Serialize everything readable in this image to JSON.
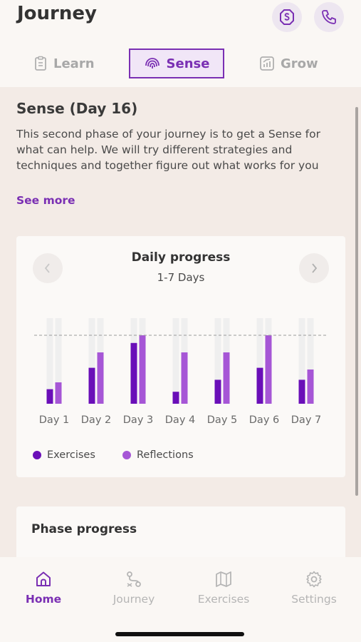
{
  "header": {
    "title": "Journey",
    "sos_icon": "sos-icon",
    "phone_icon": "phone-icon"
  },
  "tabs": [
    {
      "label": "Learn",
      "icon": "clipboard-icon",
      "active": false
    },
    {
      "label": "Sense",
      "icon": "fingerprint-icon",
      "active": true
    },
    {
      "label": "Grow",
      "icon": "growth-chart-icon",
      "active": false
    }
  ],
  "section": {
    "title": "Sense (Day 16)",
    "description": "This second phase of your journey is to get a Sense for what can help. We will try different strategies and techniques and together figure out what works for you",
    "see_more": "See more"
  },
  "daily_progress": {
    "title": "Daily progress",
    "subtitle": "1-7 Days",
    "legend": [
      "Exercises",
      "Reflections"
    ]
  },
  "chart_data": {
    "type": "bar",
    "title": "Daily progress",
    "subtitle": "1-7 Days",
    "categories": [
      "Day 1",
      "Day 2",
      "Day 3",
      "Day 4",
      "Day 5",
      "Day 6",
      "Day 7"
    ],
    "series": [
      {
        "name": "Exercises",
        "values": [
          0.17,
          0.42,
          0.71,
          0.14,
          0.28,
          0.42,
          0.28
        ]
      },
      {
        "name": "Reflections",
        "values": [
          0.25,
          0.6,
          0.8,
          0.6,
          0.6,
          0.8,
          0.4
        ]
      }
    ],
    "ylim": [
      0,
      1
    ],
    "target_line": 0.8,
    "colors": {
      "Exercises": "#6a0fb8",
      "Reflections": "#a656d6",
      "track": "#efefef"
    }
  },
  "phase_progress": {
    "title": "Phase progress"
  },
  "bottom_nav": [
    {
      "label": "Home",
      "icon": "home-icon",
      "active": true
    },
    {
      "label": "Journey",
      "icon": "journey-icon",
      "active": false
    },
    {
      "label": "Exercises",
      "icon": "map-icon",
      "active": false
    },
    {
      "label": "Settings",
      "icon": "gear-icon",
      "active": false
    }
  ],
  "colors": {
    "accent": "#7a2fb3",
    "background": "#f3ebe6",
    "surface": "#faf7f4"
  }
}
